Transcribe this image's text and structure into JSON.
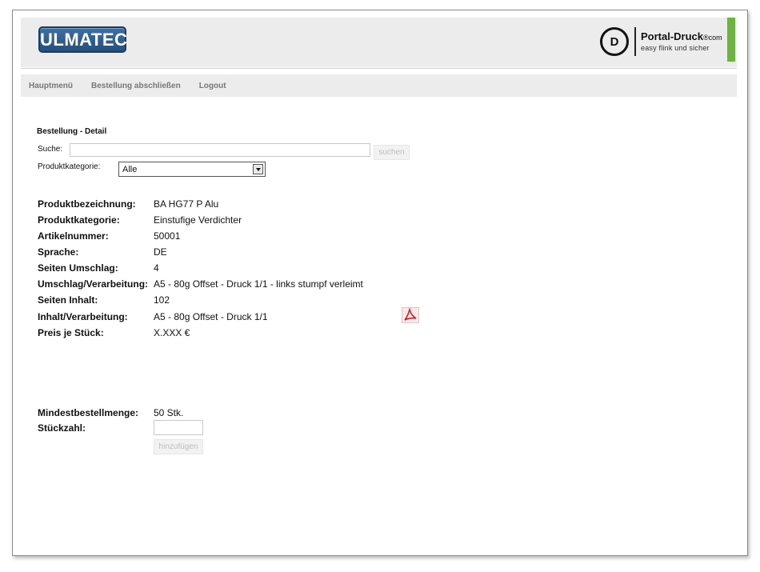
{
  "header": {
    "brand_logo_text": "ULMATEC",
    "portal_logo": {
      "mark": "D",
      "name_main": "Portal-Druck",
      "name_suffix": "®com",
      "tagline": "easy flink und sicher"
    },
    "accent_color": "#6cb33f"
  },
  "nav": {
    "items": [
      {
        "label": "Hauptmenü"
      },
      {
        "label": "Bestellung abschließen"
      },
      {
        "label": "Logout"
      }
    ]
  },
  "main": {
    "section_title": "Bestellung - Detail",
    "search": {
      "label": "Suche:",
      "value": "",
      "button_label": "suchen"
    },
    "category": {
      "label": "Produktkategorie:",
      "selected": "Alle"
    },
    "details": [
      {
        "key": "Produktbezeichnung:",
        "value": "BA HG77 P Alu"
      },
      {
        "key": "Produktkategorie:",
        "value": "Einstufige Verdichter"
      },
      {
        "key": "Artikelnummer:",
        "value": "50001"
      },
      {
        "key": "Sprache:",
        "value": "DE"
      },
      {
        "key": "Seiten Umschlag:",
        "value": "4"
      },
      {
        "key": "Umschlag/Verarbeitung:",
        "value": "A5 - 80g Offset - Druck 1/1 - links stumpf verleimt"
      },
      {
        "key": "Seiten Inhalt:",
        "value": "102"
      },
      {
        "key": "Inhalt/Verarbeitung:",
        "value": "A5 - 80g Offset - Druck 1/1"
      },
      {
        "key": "Preis je Stück:",
        "value": "X.XXX €"
      }
    ],
    "pdf_icon": "pdf-icon",
    "min_order": {
      "key": "Mindestbestellmenge:",
      "value": "50 Stk."
    },
    "quantity": {
      "key": "Stückzahl:",
      "value": "",
      "button_label": "hinzufügen"
    }
  }
}
